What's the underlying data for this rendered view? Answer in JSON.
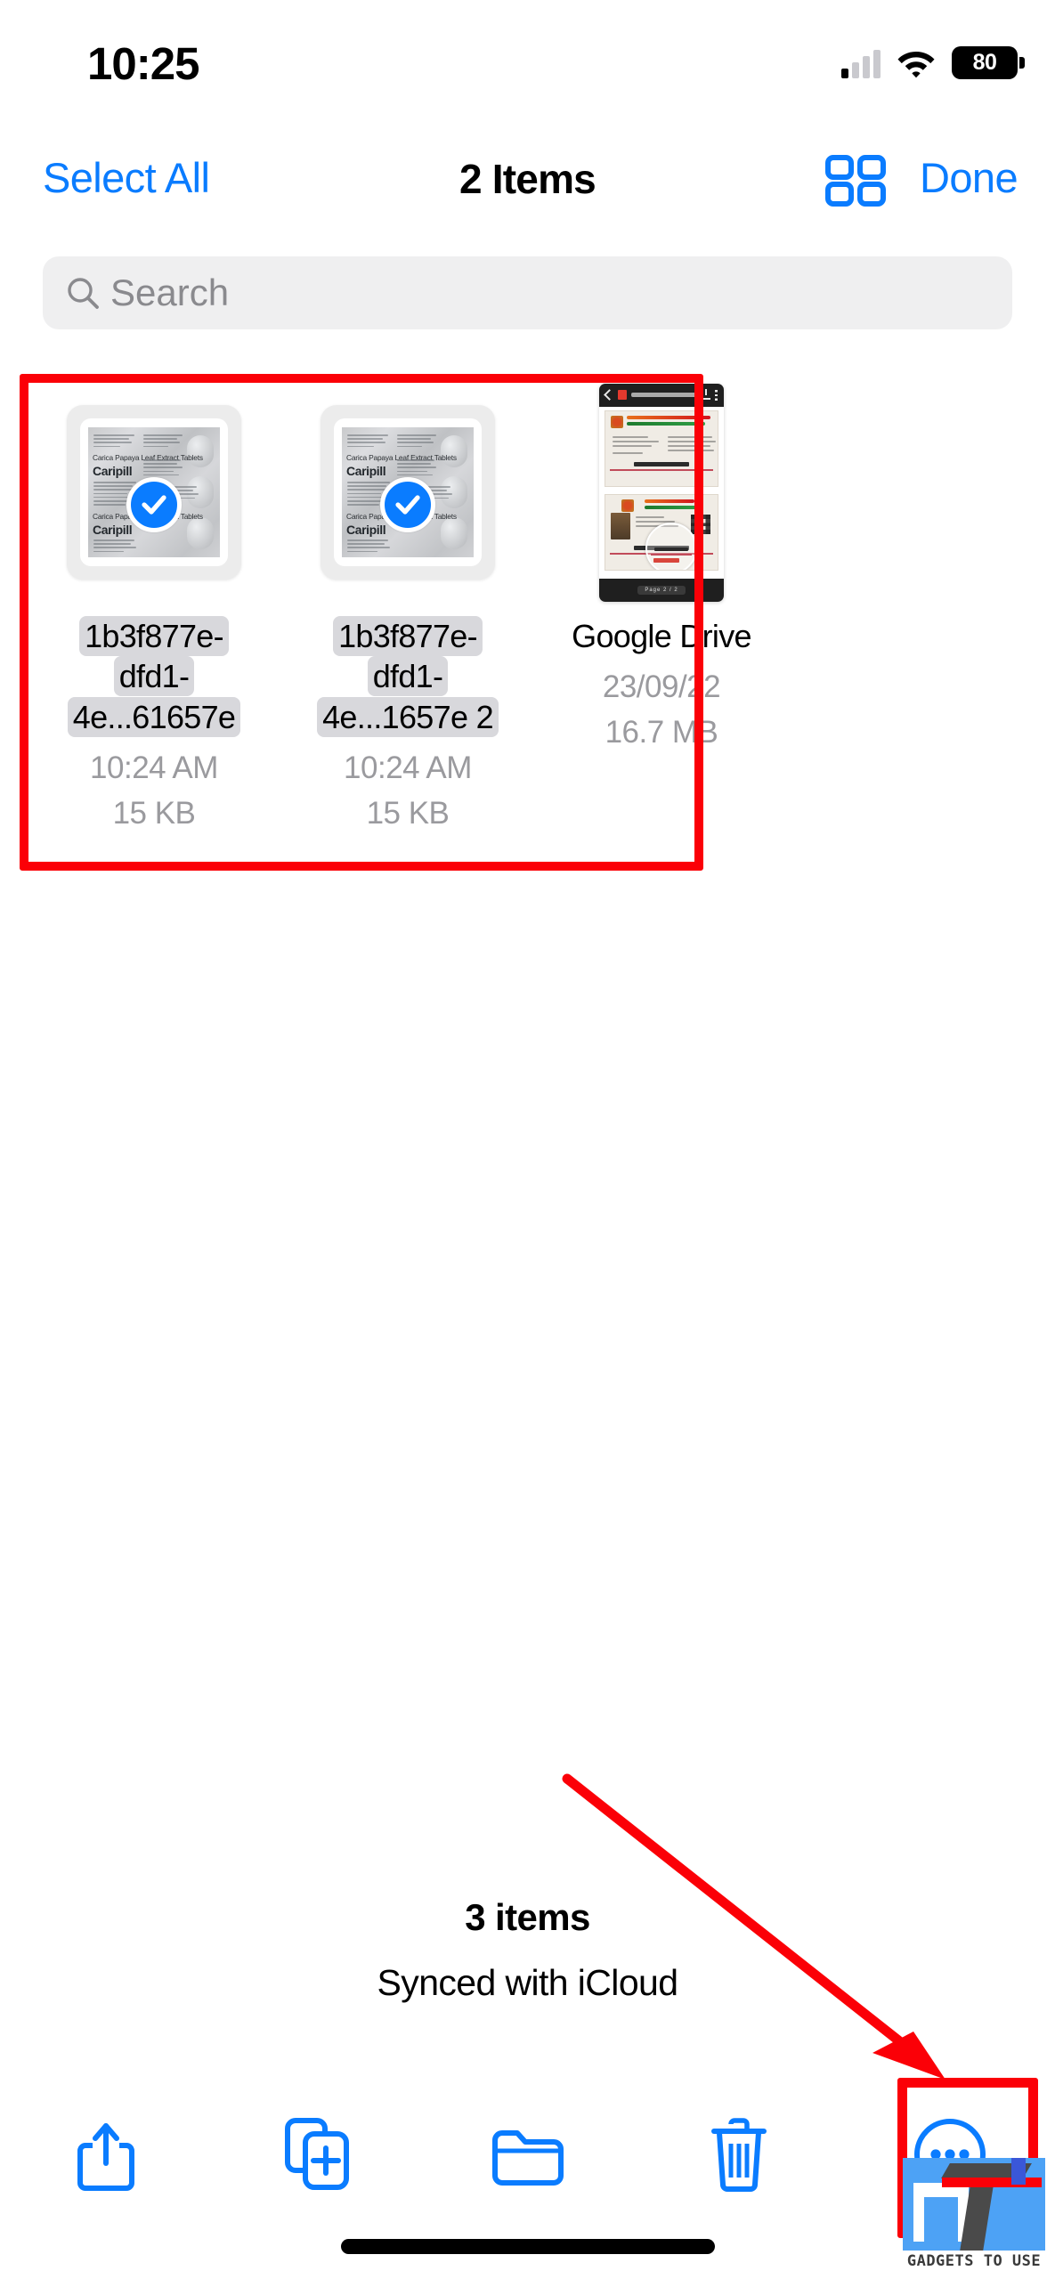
{
  "status_bar": {
    "time": "10:25",
    "battery_level": "80",
    "signal_icon": "cellular-signal-icon",
    "wifi_icon": "wifi-icon",
    "battery_icon": "battery-icon"
  },
  "nav_bar": {
    "select_all_label": "Select All",
    "title": "2 Items",
    "grid_view_icon": "grid-view-icon",
    "done_label": "Done"
  },
  "search": {
    "placeholder": "Search",
    "value": "",
    "icon": "search-icon"
  },
  "files": [
    {
      "name": "1b3f877e-dfd1-4e...61657e",
      "time": "10:24 AM",
      "size": "15 KB",
      "selected": true,
      "thumbnail_kind": "pill-packet-photo",
      "thumbnail_text": {
        "product": "Carica Papaya Leaf Extract Tablets",
        "brand": "Caripill"
      }
    },
    {
      "name": "1b3f877e-dfd1-4e...1657e 2",
      "time": "10:24 AM",
      "size": "15 KB",
      "selected": true,
      "thumbnail_kind": "pill-packet-photo",
      "thumbnail_text": {
        "product": "Carica Papaya Leaf Extract Tablets",
        "brand": "Caripill"
      }
    },
    {
      "name": "Google Drive",
      "time": "23/09/22",
      "size": "16.7 MB",
      "selected": false,
      "thumbnail_kind": "pdf-viewer-screenshot",
      "thumbnail_text": {
        "page_label": "Page 2 / 2"
      }
    }
  ],
  "footer": {
    "count": "3 items",
    "sync_status": "Synced with iCloud"
  },
  "toolbar": [
    {
      "name": "share-button",
      "icon": "share-icon"
    },
    {
      "name": "duplicate-button",
      "icon": "duplicate-icon"
    },
    {
      "name": "move-to-folder-button",
      "icon": "folder-icon"
    },
    {
      "name": "delete-button",
      "icon": "trash-icon"
    },
    {
      "name": "more-button",
      "icon": "ellipsis-circle-icon"
    }
  ],
  "annotations": {
    "highlight_color": "#fb0007",
    "selection_box_label": "selected-files-highlight",
    "more_box_label": "more-button-highlight",
    "arrow_label": "pointer-arrow-to-more-button"
  },
  "watermark": {
    "text": "GADGETS TO USE"
  },
  "theme": {
    "accent_blue": "#0a7cff",
    "search_bg": "#efeff0",
    "name_chip_bg": "#d8d8dc",
    "meta_gray": "#9a9a9e"
  }
}
